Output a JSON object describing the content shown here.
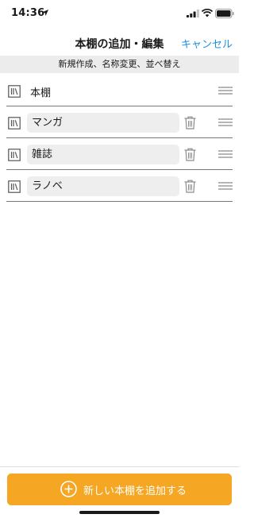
{
  "status_bar": {
    "time": "14:36"
  },
  "nav": {
    "title": "本棚の追加・編集",
    "cancel_label": "キャンセル"
  },
  "subtitle": "新規作成、名称変更、並べ替え",
  "shelves": [
    {
      "name": "本棚",
      "editable": false
    },
    {
      "name": "マンガ",
      "editable": true
    },
    {
      "name": "雑誌",
      "editable": true
    },
    {
      "name": "ラノベ",
      "editable": true
    }
  ],
  "add_button": {
    "label": "新しい本棚を追加する",
    "color": "#f5a623"
  },
  "colors": {
    "accent_link": "#1f8fe0",
    "band_background": "#ececec",
    "field_background": "#eeeeee"
  },
  "icons": {
    "shelf": "bookshelf-icon",
    "delete": "trash-icon",
    "reorder": "drag-handle-icon",
    "add": "plus-circle-icon"
  }
}
